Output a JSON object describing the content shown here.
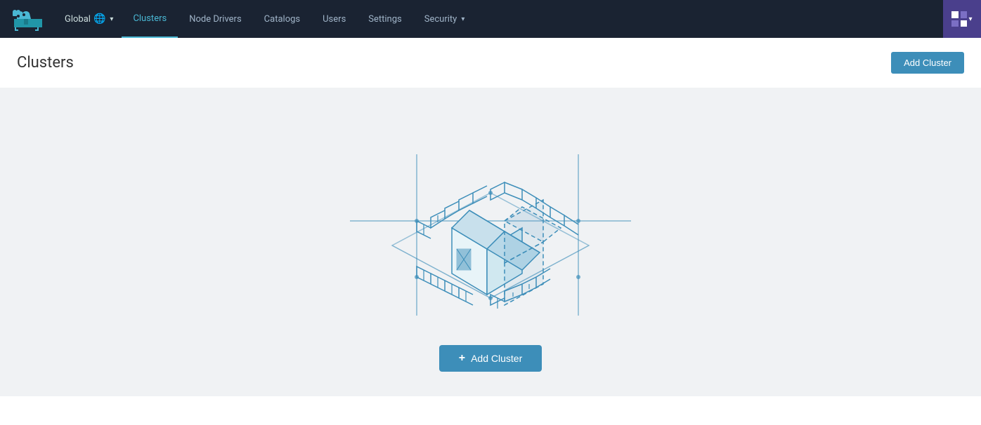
{
  "navbar": {
    "brand_alt": "Rancher",
    "global_label": "Global",
    "nav_items": [
      {
        "id": "clusters",
        "label": "Clusters",
        "active": true,
        "has_chevron": false
      },
      {
        "id": "node-drivers",
        "label": "Node Drivers",
        "active": false,
        "has_chevron": false
      },
      {
        "id": "catalogs",
        "label": "Catalogs",
        "active": false,
        "has_chevron": false
      },
      {
        "id": "users",
        "label": "Users",
        "active": false,
        "has_chevron": false
      },
      {
        "id": "settings",
        "label": "Settings",
        "active": false,
        "has_chevron": false
      },
      {
        "id": "security",
        "label": "Security",
        "active": false,
        "has_chevron": true
      }
    ]
  },
  "page": {
    "title": "Clusters",
    "add_cluster_label": "Add Cluster",
    "add_cluster_center_label": "Add Cluster"
  },
  "colors": {
    "accent": "#3d8eb9",
    "nav_bg": "#1a2332",
    "app_switcher_bg": "#4a3f8c",
    "empty_bg": "#f0f2f4",
    "illustration_stroke": "#3d8eb9"
  }
}
